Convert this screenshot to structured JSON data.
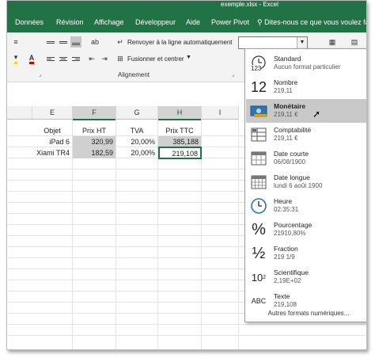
{
  "window": {
    "title_partial": "exemple.xlsx - Excel"
  },
  "ribbon_tabs": [
    {
      "label": "Données"
    },
    {
      "label": "Révision"
    },
    {
      "label": "Affichage"
    },
    {
      "label": "Développeur"
    },
    {
      "label": "Aide"
    },
    {
      "label": "Power Pivot"
    }
  ],
  "tell_me": {
    "text": "Dites-nous ce que vous voulez faire"
  },
  "ribbon": {
    "wrap_text_label": "Renvoyer à la ligne automatiquement",
    "merge_label": "Fusionner et centrer",
    "group_label": "Alignement",
    "number_format_value": ""
  },
  "columns": [
    "E",
    "F",
    "G",
    "H",
    "I"
  ],
  "rows": [
    {
      "e": "Objet",
      "f": "Prix HT",
      "g": "TVA",
      "h": "Prix TTC"
    },
    {
      "e": "iPad 6",
      "f": "320,99",
      "g": "20,00%",
      "h": "385,188"
    },
    {
      "e": "Xiami TR4",
      "f": "182,59",
      "g": "20,00%",
      "h": "219,108"
    }
  ],
  "number_formats": [
    {
      "name": "Standard",
      "value": "Aucun format particulier",
      "icon": "general-123-icon"
    },
    {
      "name": "Nombre",
      "value": "219,11",
      "icon": "number-12-icon"
    },
    {
      "name": "Monétaire",
      "value": "219,11 €",
      "icon": "currency-icon"
    },
    {
      "name": "Comptabilité",
      "value": "219,11 €",
      "icon": "accounting-icon"
    },
    {
      "name": "Date courte",
      "value": "06/08/1900",
      "icon": "calendar-icon"
    },
    {
      "name": "Date longue",
      "value": "lundi 6 août 1900",
      "icon": "calendar-icon"
    },
    {
      "name": "Heure",
      "value": "02:35:31",
      "icon": "clock-icon"
    },
    {
      "name": "Pourcentage",
      "value": "21910,80%",
      "icon": "percent-icon"
    },
    {
      "name": "Fraction",
      "value": "219 1/9",
      "icon": "fraction-icon"
    },
    {
      "name": "Scientifique",
      "value": "2,19E+02",
      "icon": "scientific-icon"
    },
    {
      "name": "Texte",
      "value": "219,108",
      "icon": "abc-text-icon"
    }
  ],
  "more_formats_label": "Autres formats numériques...",
  "icons": {
    "general": "123",
    "number": "12",
    "percent": "%",
    "fraction": "½",
    "scientific_base": "10",
    "scientific_exp": "2",
    "text": "ABC"
  },
  "colors": {
    "accent": "#217346",
    "selected_cell": "#d0d0d0",
    "hover_item": "#c9c9c9"
  }
}
